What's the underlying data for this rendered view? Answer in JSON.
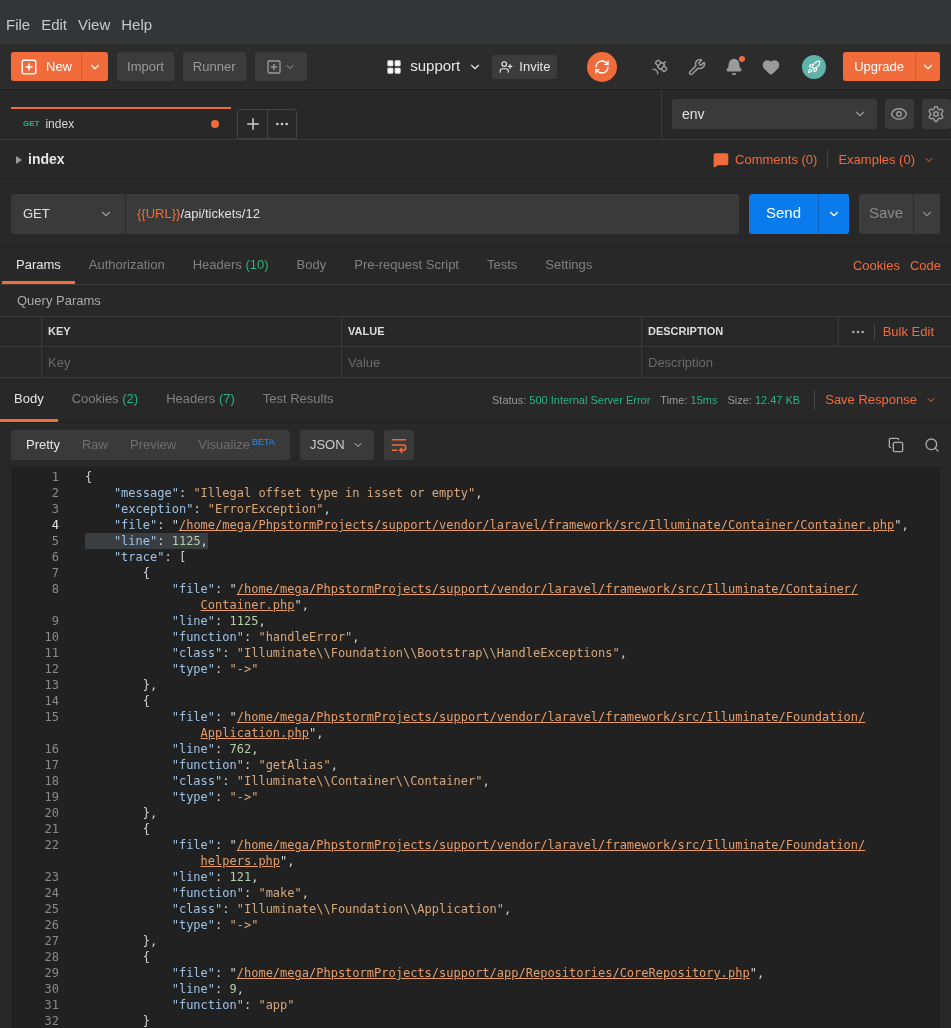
{
  "menu": [
    "File",
    "Edit",
    "View",
    "Help"
  ],
  "toolbar": {
    "new_label": "New",
    "import_label": "Import",
    "runner_label": "Runner",
    "workspace": "support",
    "invite_label": "Invite",
    "upgrade_label": "Upgrade",
    "notification_dot": true
  },
  "request_tabs": [
    {
      "method": "GET",
      "name": "index",
      "selected": true,
      "unsaved": true
    }
  ],
  "environment": {
    "value": "env"
  },
  "request": {
    "name": "index",
    "comments": "Comments (0)",
    "examples": "Examples (0)",
    "method": "GET",
    "url_variable": "{{URL}}",
    "url_path": "/api/tickets/12",
    "send_label": "Send",
    "save_label": "Save"
  },
  "request_sections": [
    {
      "label": "Params",
      "selected": true
    },
    {
      "label": "Authorization",
      "selected": false
    },
    {
      "label": "Headers",
      "count": "(10)",
      "selected": false
    },
    {
      "label": "Body",
      "selected": false
    },
    {
      "label": "Pre-request Script",
      "selected": false
    },
    {
      "label": "Tests",
      "selected": false
    },
    {
      "label": "Settings",
      "selected": false
    }
  ],
  "request_links": [
    "Cookies",
    "Code"
  ],
  "query_params": {
    "title": "Query Params",
    "columns": [
      "KEY",
      "VALUE",
      "DESCRIPTION"
    ],
    "bulk_edit": "Bulk Edit",
    "placeholders": [
      "Key",
      "Value",
      "Description"
    ]
  },
  "response_sections": [
    {
      "label": "Body",
      "selected": true
    },
    {
      "label": "Cookies",
      "count": "(2)",
      "selected": false
    },
    {
      "label": "Headers",
      "count": "(7)",
      "selected": false
    },
    {
      "label": "Test Results",
      "selected": false
    }
  ],
  "response_meta": [
    {
      "label": "Status:",
      "value": "500 Internal Server Error"
    },
    {
      "label": "Time:",
      "value": "15ms"
    },
    {
      "label": "Size:",
      "value": "12.47 KB"
    }
  ],
  "save_response": "Save Response",
  "view_modes": [
    {
      "label": "Pretty",
      "selected": true
    },
    {
      "label": "Raw",
      "selected": false
    },
    {
      "label": "Preview",
      "selected": false
    },
    {
      "label": "Visualize",
      "badge": "BETA",
      "selected": false
    }
  ],
  "format": "JSON",
  "code_lines": [
    {
      "number": "1",
      "current": false,
      "selected": false,
      "tokens": [
        {
          "kind": "punct",
          "text": "{"
        }
      ]
    },
    {
      "number": "2",
      "current": false,
      "selected": false,
      "tokens": [
        {
          "kind": "key",
          "text": "    \"message\""
        },
        {
          "kind": "punct",
          "text": ": "
        },
        {
          "kind": "string",
          "text": "\"Illegal offset type in isset or empty\""
        },
        {
          "kind": "punct",
          "text": ","
        }
      ]
    },
    {
      "number": "3",
      "current": false,
      "selected": false,
      "tokens": [
        {
          "kind": "key",
          "text": "    \"exception\""
        },
        {
          "kind": "punct",
          "text": ": "
        },
        {
          "kind": "string",
          "text": "\"ErrorException\""
        },
        {
          "kind": "punct",
          "text": ","
        }
      ]
    },
    {
      "number": "4",
      "current": true,
      "selected": false,
      "tokens": [
        {
          "kind": "key",
          "text": "    \"file\""
        },
        {
          "kind": "punct",
          "text": ": \""
        },
        {
          "kind": "link",
          "text": "/home/mega/PhpstormProjects/support/vendor/laravel/framework/src/Illuminate/Container/Container.php"
        },
        {
          "kind": "punct",
          "text": "\","
        }
      ]
    },
    {
      "number": "5",
      "current": false,
      "selected": true,
      "tokens": [
        {
          "kind": "key",
          "text": "    \"line\""
        },
        {
          "kind": "punct",
          "text": ": "
        },
        {
          "kind": "number",
          "text": "1125"
        },
        {
          "kind": "punct",
          "text": ","
        }
      ]
    },
    {
      "number": "6",
      "current": false,
      "selected": false,
      "tokens": [
        {
          "kind": "key",
          "text": "    \"trace\""
        },
        {
          "kind": "punct",
          "text": ": ["
        }
      ]
    },
    {
      "number": "7",
      "current": false,
      "selected": false,
      "tokens": [
        {
          "kind": "punct",
          "text": "        {"
        }
      ]
    },
    {
      "number": "8",
      "current": false,
      "selected": false,
      "tokens": [
        {
          "kind": "key",
          "text": "            \"file\""
        },
        {
          "kind": "punct",
          "text": ": \""
        },
        {
          "kind": "link",
          "text": "/home/mega/PhpstormProjects/support/vendor/laravel/framework/src/Illuminate/Container/"
        }
      ],
      "wrap": [
        {
          "kind": "link",
          "text": "Container.php"
        },
        {
          "kind": "punct",
          "text": "\","
        }
      ]
    },
    {
      "number": "9",
      "current": false,
      "selected": false,
      "tokens": [
        {
          "kind": "key",
          "text": "            \"line\""
        },
        {
          "kind": "punct",
          "text": ": "
        },
        {
          "kind": "number",
          "text": "1125"
        },
        {
          "kind": "punct",
          "text": ","
        }
      ]
    },
    {
      "number": "10",
      "current": false,
      "selected": false,
      "tokens": [
        {
          "kind": "key",
          "text": "            \"function\""
        },
        {
          "kind": "punct",
          "text": ": "
        },
        {
          "kind": "string",
          "text": "\"handleError\""
        },
        {
          "kind": "punct",
          "text": ","
        }
      ]
    },
    {
      "number": "11",
      "current": false,
      "selected": false,
      "tokens": [
        {
          "kind": "key",
          "text": "            \"class\""
        },
        {
          "kind": "punct",
          "text": ": "
        },
        {
          "kind": "string",
          "text": "\"Illuminate\\\\Foundation\\\\Bootstrap\\\\HandleExceptions\""
        },
        {
          "kind": "punct",
          "text": ","
        }
      ]
    },
    {
      "number": "12",
      "current": false,
      "selected": false,
      "tokens": [
        {
          "kind": "key",
          "text": "            \"type\""
        },
        {
          "kind": "punct",
          "text": ": "
        },
        {
          "kind": "string",
          "text": "\"->\""
        }
      ]
    },
    {
      "number": "13",
      "current": false,
      "selected": false,
      "tokens": [
        {
          "kind": "punct",
          "text": "        },"
        }
      ]
    },
    {
      "number": "14",
      "current": false,
      "selected": false,
      "tokens": [
        {
          "kind": "punct",
          "text": "        {"
        }
      ]
    },
    {
      "number": "15",
      "current": false,
      "selected": false,
      "tokens": [
        {
          "kind": "key",
          "text": "            \"file\""
        },
        {
          "kind": "punct",
          "text": ": \""
        },
        {
          "kind": "link",
          "text": "/home/mega/PhpstormProjects/support/vendor/laravel/framework/src/Illuminate/Foundation/"
        }
      ],
      "wrap": [
        {
          "kind": "link",
          "text": "Application.php"
        },
        {
          "kind": "punct",
          "text": "\","
        }
      ]
    },
    {
      "number": "16",
      "current": false,
      "selected": false,
      "tokens": [
        {
          "kind": "key",
          "text": "            \"line\""
        },
        {
          "kind": "punct",
          "text": ": "
        },
        {
          "kind": "number",
          "text": "762"
        },
        {
          "kind": "punct",
          "text": ","
        }
      ]
    },
    {
      "number": "17",
      "current": false,
      "selected": false,
      "tokens": [
        {
          "kind": "key",
          "text": "            \"function\""
        },
        {
          "kind": "punct",
          "text": ": "
        },
        {
          "kind": "string",
          "text": "\"getAlias\""
        },
        {
          "kind": "punct",
          "text": ","
        }
      ]
    },
    {
      "number": "18",
      "current": false,
      "selected": false,
      "tokens": [
        {
          "kind": "key",
          "text": "            \"class\""
        },
        {
          "kind": "punct",
          "text": ": "
        },
        {
          "kind": "string",
          "text": "\"Illuminate\\\\Container\\\\Container\""
        },
        {
          "kind": "punct",
          "text": ","
        }
      ]
    },
    {
      "number": "19",
      "current": false,
      "selected": false,
      "tokens": [
        {
          "kind": "key",
          "text": "            \"type\""
        },
        {
          "kind": "punct",
          "text": ": "
        },
        {
          "kind": "string",
          "text": "\"->\""
        }
      ]
    },
    {
      "number": "20",
      "current": false,
      "selected": false,
      "tokens": [
        {
          "kind": "punct",
          "text": "        },"
        }
      ]
    },
    {
      "number": "21",
      "current": false,
      "selected": false,
      "tokens": [
        {
          "kind": "punct",
          "text": "        {"
        }
      ]
    },
    {
      "number": "22",
      "current": false,
      "selected": false,
      "tokens": [
        {
          "kind": "key",
          "text": "            \"file\""
        },
        {
          "kind": "punct",
          "text": ": \""
        },
        {
          "kind": "link",
          "text": "/home/mega/PhpstormProjects/support/vendor/laravel/framework/src/Illuminate/Foundation/"
        }
      ],
      "wrap": [
        {
          "kind": "link",
          "text": "helpers.php"
        },
        {
          "kind": "punct",
          "text": "\","
        }
      ]
    },
    {
      "number": "23",
      "current": false,
      "selected": false,
      "tokens": [
        {
          "kind": "key",
          "text": "            \"line\""
        },
        {
          "kind": "punct",
          "text": ": "
        },
        {
          "kind": "number",
          "text": "121"
        },
        {
          "kind": "punct",
          "text": ","
        }
      ]
    },
    {
      "number": "24",
      "current": false,
      "selected": false,
      "tokens": [
        {
          "kind": "key",
          "text": "            \"function\""
        },
        {
          "kind": "punct",
          "text": ": "
        },
        {
          "kind": "string",
          "text": "\"make\""
        },
        {
          "kind": "punct",
          "text": ","
        }
      ]
    },
    {
      "number": "25",
      "current": false,
      "selected": false,
      "tokens": [
        {
          "kind": "key",
          "text": "            \"class\""
        },
        {
          "kind": "punct",
          "text": ": "
        },
        {
          "kind": "string",
          "text": "\"Illuminate\\\\Foundation\\\\Application\""
        },
        {
          "kind": "punct",
          "text": ","
        }
      ]
    },
    {
      "number": "26",
      "current": false,
      "selected": false,
      "tokens": [
        {
          "kind": "key",
          "text": "            \"type\""
        },
        {
          "kind": "punct",
          "text": ": "
        },
        {
          "kind": "string",
          "text": "\"->\""
        }
      ]
    },
    {
      "number": "27",
      "current": false,
      "selected": false,
      "tokens": [
        {
          "kind": "punct",
          "text": "        },"
        }
      ]
    },
    {
      "number": "28",
      "current": false,
      "selected": false,
      "tokens": [
        {
          "kind": "punct",
          "text": "        {"
        }
      ]
    },
    {
      "number": "29",
      "current": false,
      "selected": false,
      "tokens": [
        {
          "kind": "key",
          "text": "            \"file\""
        },
        {
          "kind": "punct",
          "text": ": \""
        },
        {
          "kind": "link",
          "text": "/home/mega/PhpstormProjects/support/app/Repositories/CoreRepository.php"
        },
        {
          "kind": "punct",
          "text": "\","
        }
      ]
    },
    {
      "number": "30",
      "current": false,
      "selected": false,
      "tokens": [
        {
          "kind": "key",
          "text": "            \"line\""
        },
        {
          "kind": "punct",
          "text": ": "
        },
        {
          "kind": "number",
          "text": "9"
        },
        {
          "kind": "punct",
          "text": ","
        }
      ]
    },
    {
      "number": "31",
      "current": false,
      "selected": false,
      "tokens": [
        {
          "kind": "key",
          "text": "            \"function\""
        },
        {
          "kind": "punct",
          "text": ": "
        },
        {
          "kind": "string",
          "text": "\"app\""
        }
      ]
    },
    {
      "number": "32",
      "current": false,
      "selected": false,
      "tokens": [
        {
          "kind": "punct",
          "text": "        }"
        }
      ]
    }
  ]
}
